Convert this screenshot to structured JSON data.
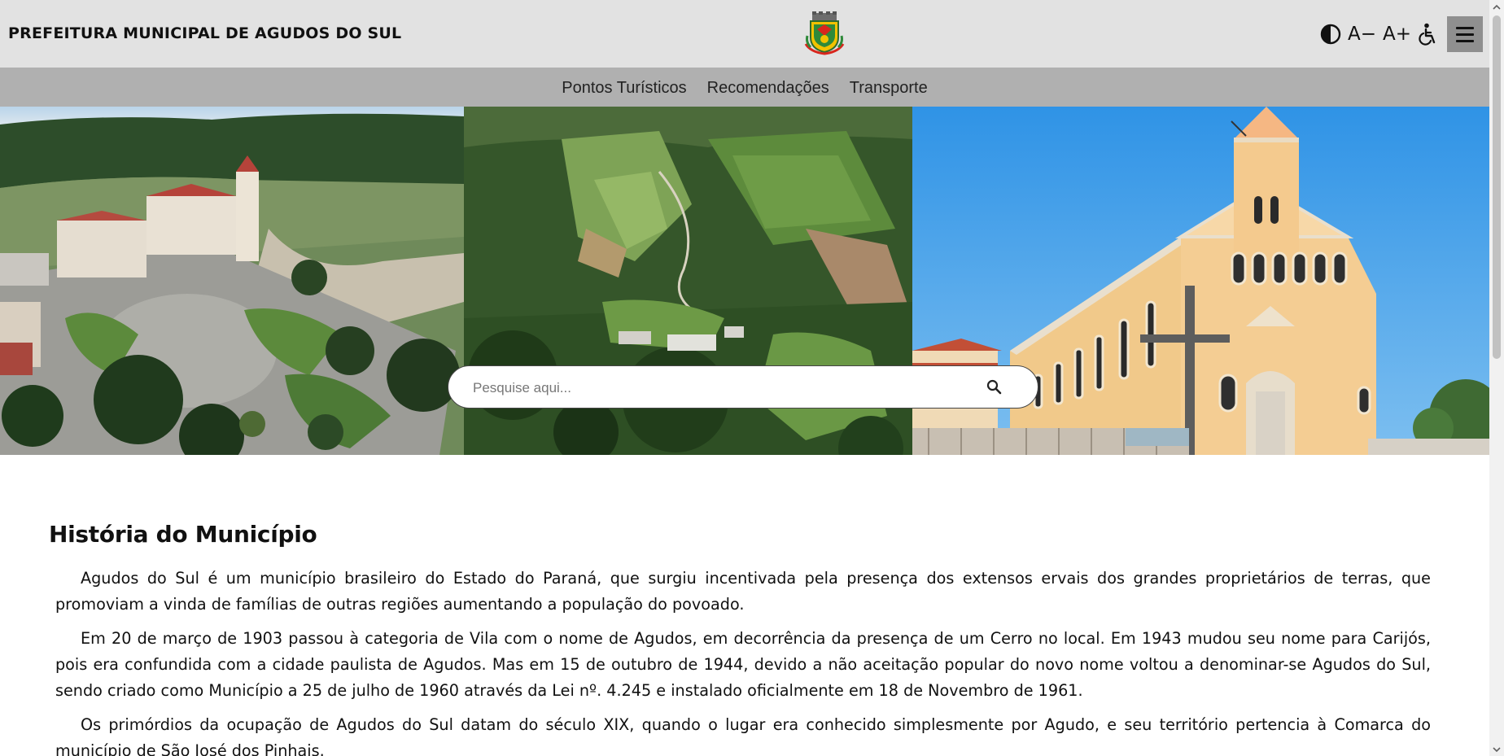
{
  "header": {
    "site_title": "PREFEITURA MUNICIPAL DE AGUDOS DO SUL",
    "tools": {
      "contrast_icon": "contrast-icon",
      "font_decrease_label": "A−",
      "font_increase_label": "A+",
      "accessibility_icon": "wheelchair-icon",
      "menu_icon": "hamburger-menu-icon"
    }
  },
  "nav": {
    "items": [
      {
        "label": "Pontos Turísticos"
      },
      {
        "label": "Recomendações"
      },
      {
        "label": "Transporte"
      }
    ]
  },
  "hero": {
    "search_placeholder": "Pesquise aqui...",
    "search_icon": "search-icon"
  },
  "content": {
    "title": "História do Município",
    "paragraphs": [
      "Agudos do Sul é um município brasileiro do Estado do Paraná, que surgiu incentivada pela presença dos extensos ervais dos grandes proprietários de terras, que promoviam a vinda de famílias de outras regiões aumentando a população do povoado.",
      "Em 20 de março de 1903 passou à categoria de Vila com o nome de Agudos, em decorrência da presença de um Cerro no local. Em 1943 mudou seu nome para Carijós, pois era confundida com a cidade paulista de Agudos. Mas em 15 de outubro de 1944, devido a não aceitação popular do novo nome voltou a denominar-se Agudos do Sul, sendo criado como Município a 25 de julho de 1960 através da Lei nº. 4.245 e instalado oficialmente em 18 de Novembro de 1961.",
      "Os primórdios da ocupação de Agudos do Sul datam do século XIX, quando o lugar era conhecido simplesmente por Agudo, e seu território pertencia à Comarca do município de São José dos Pinhais."
    ]
  },
  "colors": {
    "header_bg": "#e2e2e2",
    "nav_bg": "#b0b0b0",
    "menu_button_bg": "#8f8f8f",
    "text": "#111111"
  }
}
